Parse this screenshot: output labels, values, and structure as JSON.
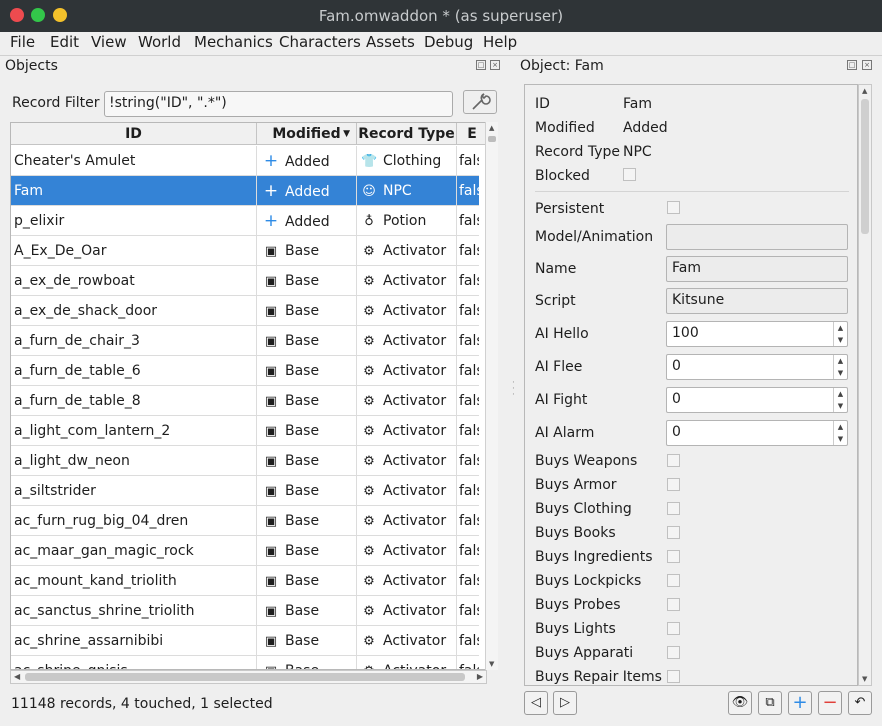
{
  "window": {
    "title": "Fam.omwaddon * (as superuser)"
  },
  "menu": [
    "File",
    "Edit",
    "View",
    "World",
    "Mechanics",
    "Characters",
    "Assets",
    "Debug",
    "Help"
  ],
  "objects_panel": {
    "title": "Objects",
    "filter_label": "Record Filter",
    "filter_value": "!string(\"ID\", \".*\")",
    "columns": [
      "ID",
      "Modified",
      "Record Type",
      "E"
    ],
    "rows": [
      {
        "id": "Cheater's Amulet",
        "modified": "Added",
        "mod_icon": "plus-icon",
        "type": "Clothing",
        "type_icon": "shirt-icon",
        "b": "false",
        "selected": false
      },
      {
        "id": "Fam",
        "modified": "Added",
        "mod_icon": "plus-icon",
        "type": "NPC",
        "type_icon": "npc-face-icon",
        "b": "false",
        "selected": true
      },
      {
        "id": "p_elixir",
        "modified": "Added",
        "mod_icon": "plus-icon",
        "type": "Potion",
        "type_icon": "potion-icon",
        "b": "false",
        "selected": false
      },
      {
        "id": "A_Ex_De_Oar",
        "modified": "Base",
        "mod_icon": "base-icon",
        "type": "Activator",
        "type_icon": "gear-icon",
        "b": "false",
        "selected": false
      },
      {
        "id": "a_ex_de_rowboat",
        "modified": "Base",
        "mod_icon": "base-icon",
        "type": "Activator",
        "type_icon": "gear-icon",
        "b": "false",
        "selected": false
      },
      {
        "id": "a_ex_de_shack_door",
        "modified": "Base",
        "mod_icon": "base-icon",
        "type": "Activator",
        "type_icon": "gear-icon",
        "b": "false",
        "selected": false
      },
      {
        "id": "a_furn_de_chair_3",
        "modified": "Base",
        "mod_icon": "base-icon",
        "type": "Activator",
        "type_icon": "gear-icon",
        "b": "false",
        "selected": false
      },
      {
        "id": "a_furn_de_table_6",
        "modified": "Base",
        "mod_icon": "base-icon",
        "type": "Activator",
        "type_icon": "gear-icon",
        "b": "false",
        "selected": false
      },
      {
        "id": "a_furn_de_table_8",
        "modified": "Base",
        "mod_icon": "base-icon",
        "type": "Activator",
        "type_icon": "gear-icon",
        "b": "false",
        "selected": false
      },
      {
        "id": "a_light_com_lantern_2",
        "modified": "Base",
        "mod_icon": "base-icon",
        "type": "Activator",
        "type_icon": "gear-icon",
        "b": "false",
        "selected": false
      },
      {
        "id": "a_light_dw_neon",
        "modified": "Base",
        "mod_icon": "base-icon",
        "type": "Activator",
        "type_icon": "gear-icon",
        "b": "false",
        "selected": false
      },
      {
        "id": "a_siltstrider",
        "modified": "Base",
        "mod_icon": "base-icon",
        "type": "Activator",
        "type_icon": "gear-icon",
        "b": "false",
        "selected": false
      },
      {
        "id": "ac_furn_rug_big_04_dren",
        "modified": "Base",
        "mod_icon": "base-icon",
        "type": "Activator",
        "type_icon": "gear-icon",
        "b": "false",
        "selected": false
      },
      {
        "id": "ac_maar_gan_magic_rock",
        "modified": "Base",
        "mod_icon": "base-icon",
        "type": "Activator",
        "type_icon": "gear-icon",
        "b": "false",
        "selected": false
      },
      {
        "id": "ac_mount_kand_triolith",
        "modified": "Base",
        "mod_icon": "base-icon",
        "type": "Activator",
        "type_icon": "gear-icon",
        "b": "false",
        "selected": false
      },
      {
        "id": "ac_sanctus_shrine_triolith",
        "modified": "Base",
        "mod_icon": "base-icon",
        "type": "Activator",
        "type_icon": "gear-icon",
        "b": "false",
        "selected": false
      },
      {
        "id": "ac_shrine_assarnibibi",
        "modified": "Base",
        "mod_icon": "base-icon",
        "type": "Activator",
        "type_icon": "gear-icon",
        "b": "false",
        "selected": false
      },
      {
        "id": "ac_shrine_gnisis",
        "modified": "Base",
        "mod_icon": "base-icon",
        "type": "Activator",
        "type_icon": "gear-icon",
        "b": "false",
        "selected": false
      }
    ],
    "status": "11148 records, 4 touched, 1 selected"
  },
  "object_panel": {
    "title": "Object: Fam",
    "info": [
      {
        "label": "ID",
        "value": "Fam"
      },
      {
        "label": "Modified",
        "value": "Added"
      },
      {
        "label": "Record Type",
        "value": "NPC"
      },
      {
        "label": "Blocked",
        "value": ""
      }
    ],
    "persistent_label": "Persistent",
    "model_label": "Model/Animation",
    "model_value": "",
    "name_label": "Name",
    "name_value": "Fam",
    "script_label": "Script",
    "script_value": "Kitsune",
    "ai": [
      {
        "label": "AI Hello",
        "value": "100"
      },
      {
        "label": "AI Flee",
        "value": "0"
      },
      {
        "label": "AI Fight",
        "value": "0"
      },
      {
        "label": "AI Alarm",
        "value": "0"
      }
    ],
    "buys": [
      "Buys Weapons",
      "Buys Armor",
      "Buys Clothing",
      "Buys Books",
      "Buys Ingredients",
      "Buys Lockpicks",
      "Buys Probes",
      "Buys Lights",
      "Buys Apparati",
      "Buys Repair Items"
    ]
  },
  "icons": {
    "prev": "triangle-left-icon",
    "next": "triangle-right-icon",
    "view": "eye-icon",
    "clone": "clone-icon",
    "add": "plus-icon",
    "delete": "minus-icon",
    "revert": "undo-icon",
    "filter_tool": "wrench-icon"
  },
  "colors": {
    "selection": "#3483d6",
    "add": "#2e8be6",
    "delete": "#e0403a",
    "titlebar": "#2f3437"
  }
}
